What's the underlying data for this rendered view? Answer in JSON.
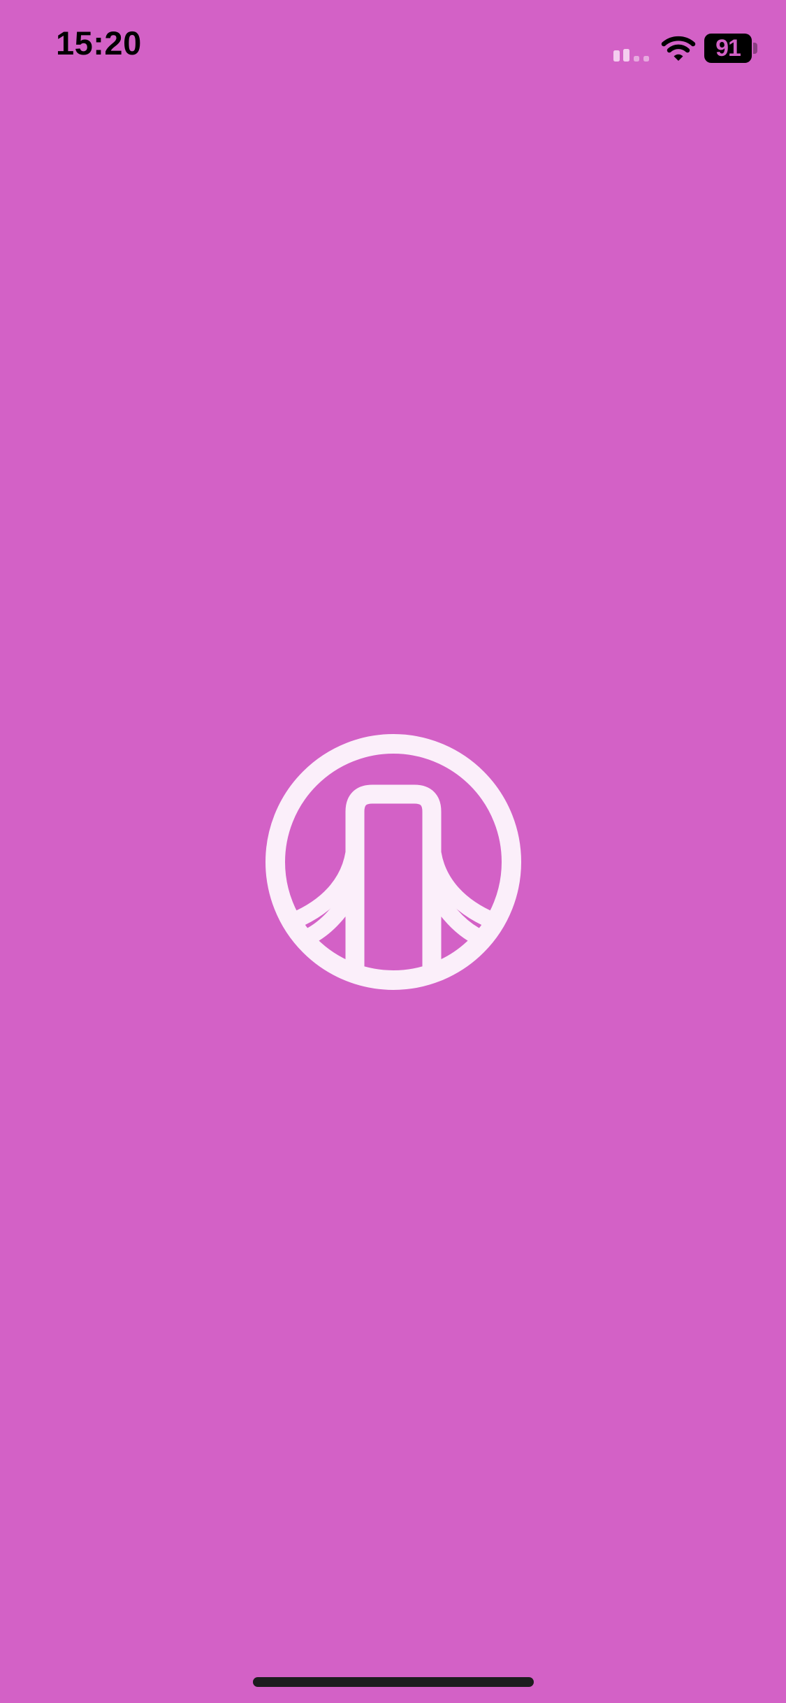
{
  "status_bar": {
    "time": "15:20",
    "battery_level": "91",
    "battery_fraction": 0.91,
    "signal_bars": 2,
    "signal_icon": "cellular-signal-icon",
    "wifi_icon": "wifi-icon"
  },
  "splash": {
    "logo_icon": "bridge-circle-logo-icon"
  },
  "colors": {
    "background": "#D361C6",
    "logo": "#FBEFFA",
    "status_text": "#000000",
    "signal_inactive": "#E7A9DF",
    "home_indicator": "#1C1C1E"
  }
}
